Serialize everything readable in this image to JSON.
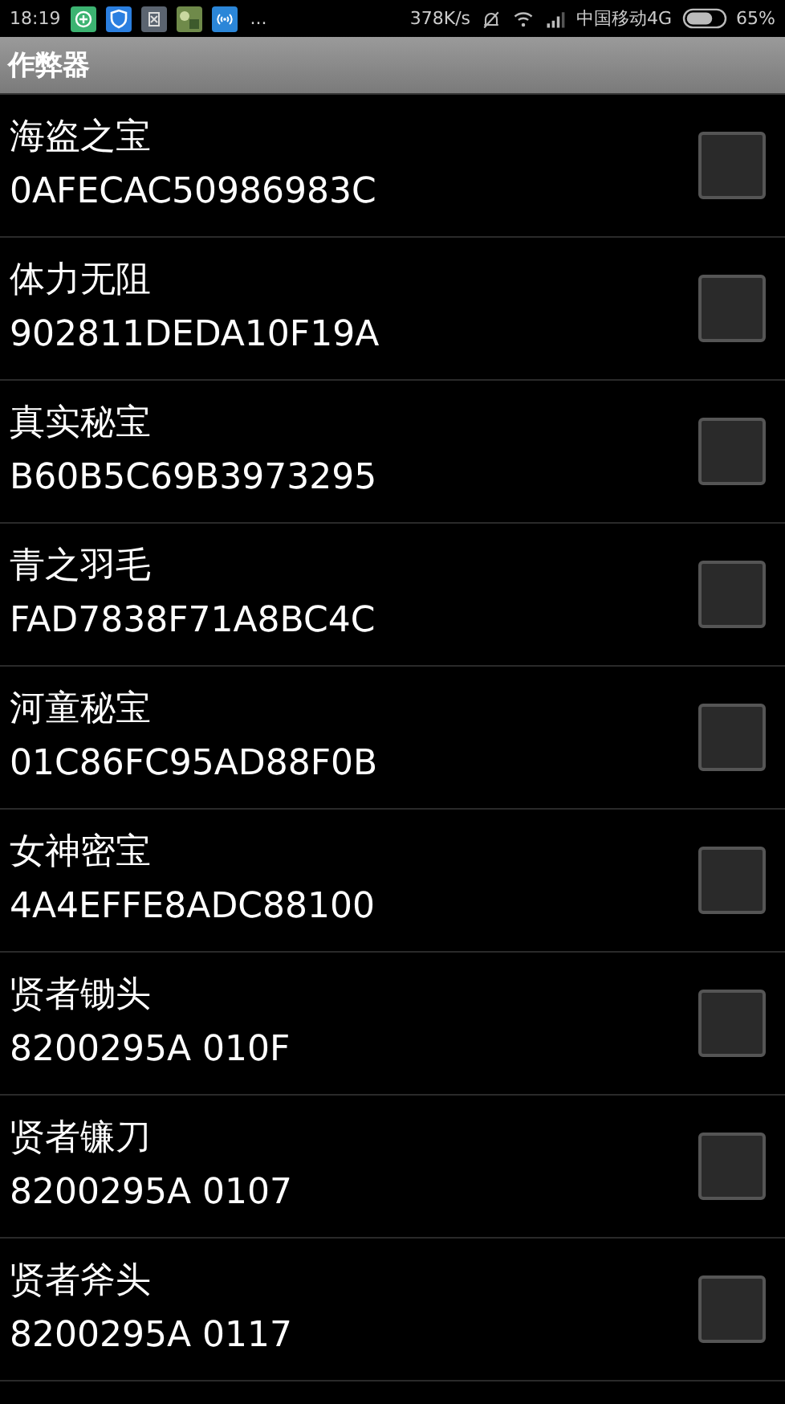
{
  "status_bar": {
    "time": "18:19",
    "more": "...",
    "speed": "378K/s",
    "carrier": "中国移动4G",
    "battery": "65%"
  },
  "title_bar": {
    "title": "作弊器"
  },
  "cheats": [
    {
      "name": "海盗之宝",
      "code": "0AFECAC50986983C",
      "checked": false
    },
    {
      "name": "体力无阻",
      "code": "902811DEDA10F19A",
      "checked": false
    },
    {
      "name": "真实秘宝",
      "code": "B60B5C69B3973295",
      "checked": false
    },
    {
      "name": "青之羽毛",
      "code": "FAD7838F71A8BC4C",
      "checked": false
    },
    {
      "name": "河童秘宝",
      "code": "01C86FC95AD88F0B",
      "checked": false
    },
    {
      "name": "女神密宝",
      "code": "4A4EFFE8ADC88100",
      "checked": false
    },
    {
      "name": "贤者锄头",
      "code": "8200295A 010F",
      "checked": false
    },
    {
      "name": "贤者镰刀",
      "code": "8200295A 0107",
      "checked": false
    },
    {
      "name": "贤者斧头",
      "code": "8200295A 0117",
      "checked": false
    }
  ]
}
